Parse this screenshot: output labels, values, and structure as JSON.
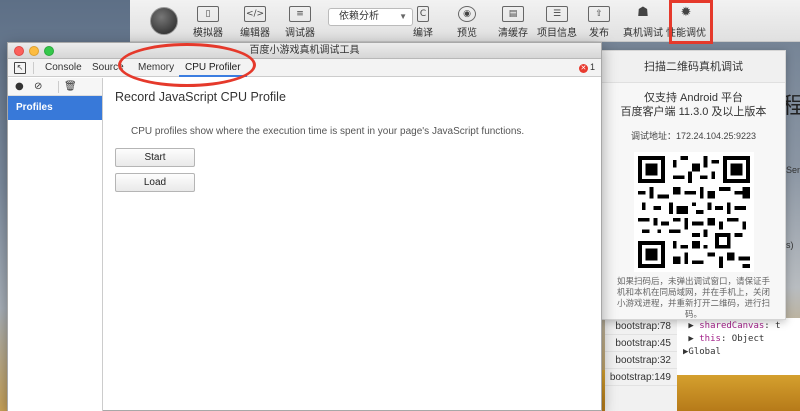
{
  "ide": {
    "mode_select": "依赖分析",
    "toolbar": [
      {
        "label": "模拟器",
        "icon": "phone-icon"
      },
      {
        "label": "编辑器",
        "icon": "code-icon"
      },
      {
        "label": "调试器",
        "icon": "sliders-icon"
      },
      {
        "label": "编译",
        "icon": "compile-icon"
      },
      {
        "label": "预览",
        "icon": "eye-icon"
      },
      {
        "label": "清缓存",
        "icon": "briefcase-icon"
      },
      {
        "label": "项目信息",
        "icon": "list-icon"
      },
      {
        "label": "发布",
        "icon": "upload-icon"
      },
      {
        "label": "真机调试",
        "icon": "android-icon"
      },
      {
        "label": "性能调优",
        "icon": "bug-icon"
      }
    ]
  },
  "remote_debug": {
    "title": "扫描二维码真机调试",
    "support_line1": "仅支持 Android 平台",
    "support_line2": "百度客户端 11.3.0 及以上版本",
    "address": "调试地址：172.24.104.25:9223",
    "note": "如果扫码后，未弹出调试窗口，请保证手机和本机在同局域网，并在手机上，关闭小游戏进程，并重新打开二维码，进行扫码。"
  },
  "devtools": {
    "window_title": "百度小游戏真机调试工具",
    "tabs": [
      "Console",
      "Sources",
      "Memory",
      "CPU Profiler"
    ],
    "active_tab": "CPU Profiler",
    "error_count": "1",
    "sidebar_item": "Profiles",
    "panel_title": "Record JavaScript CPU Profile",
    "panel_desc": "CPU profiles show where the execution time is spent in your page's JavaScript functions.",
    "start_label": "Start",
    "load_label": "Load"
  },
  "background_panel": {
    "call_stack": [
      "bootstrap:78",
      "bootstrap:45",
      "bootstrap:32",
      "bootstrap:149"
    ],
    "scope": {
      "prop1_name": "sharedCanvas",
      "prop1_value": "t",
      "prop2_name": "this",
      "prop2_value": "Object",
      "global_label": "Global"
    },
    "big_char": "程",
    "edge_frag1": "Sens",
    "edge_frag2": "s)"
  },
  "colors": {
    "accent": "#3b7de0",
    "selection": "#3879d9",
    "highlight_red": "#e5392b"
  }
}
